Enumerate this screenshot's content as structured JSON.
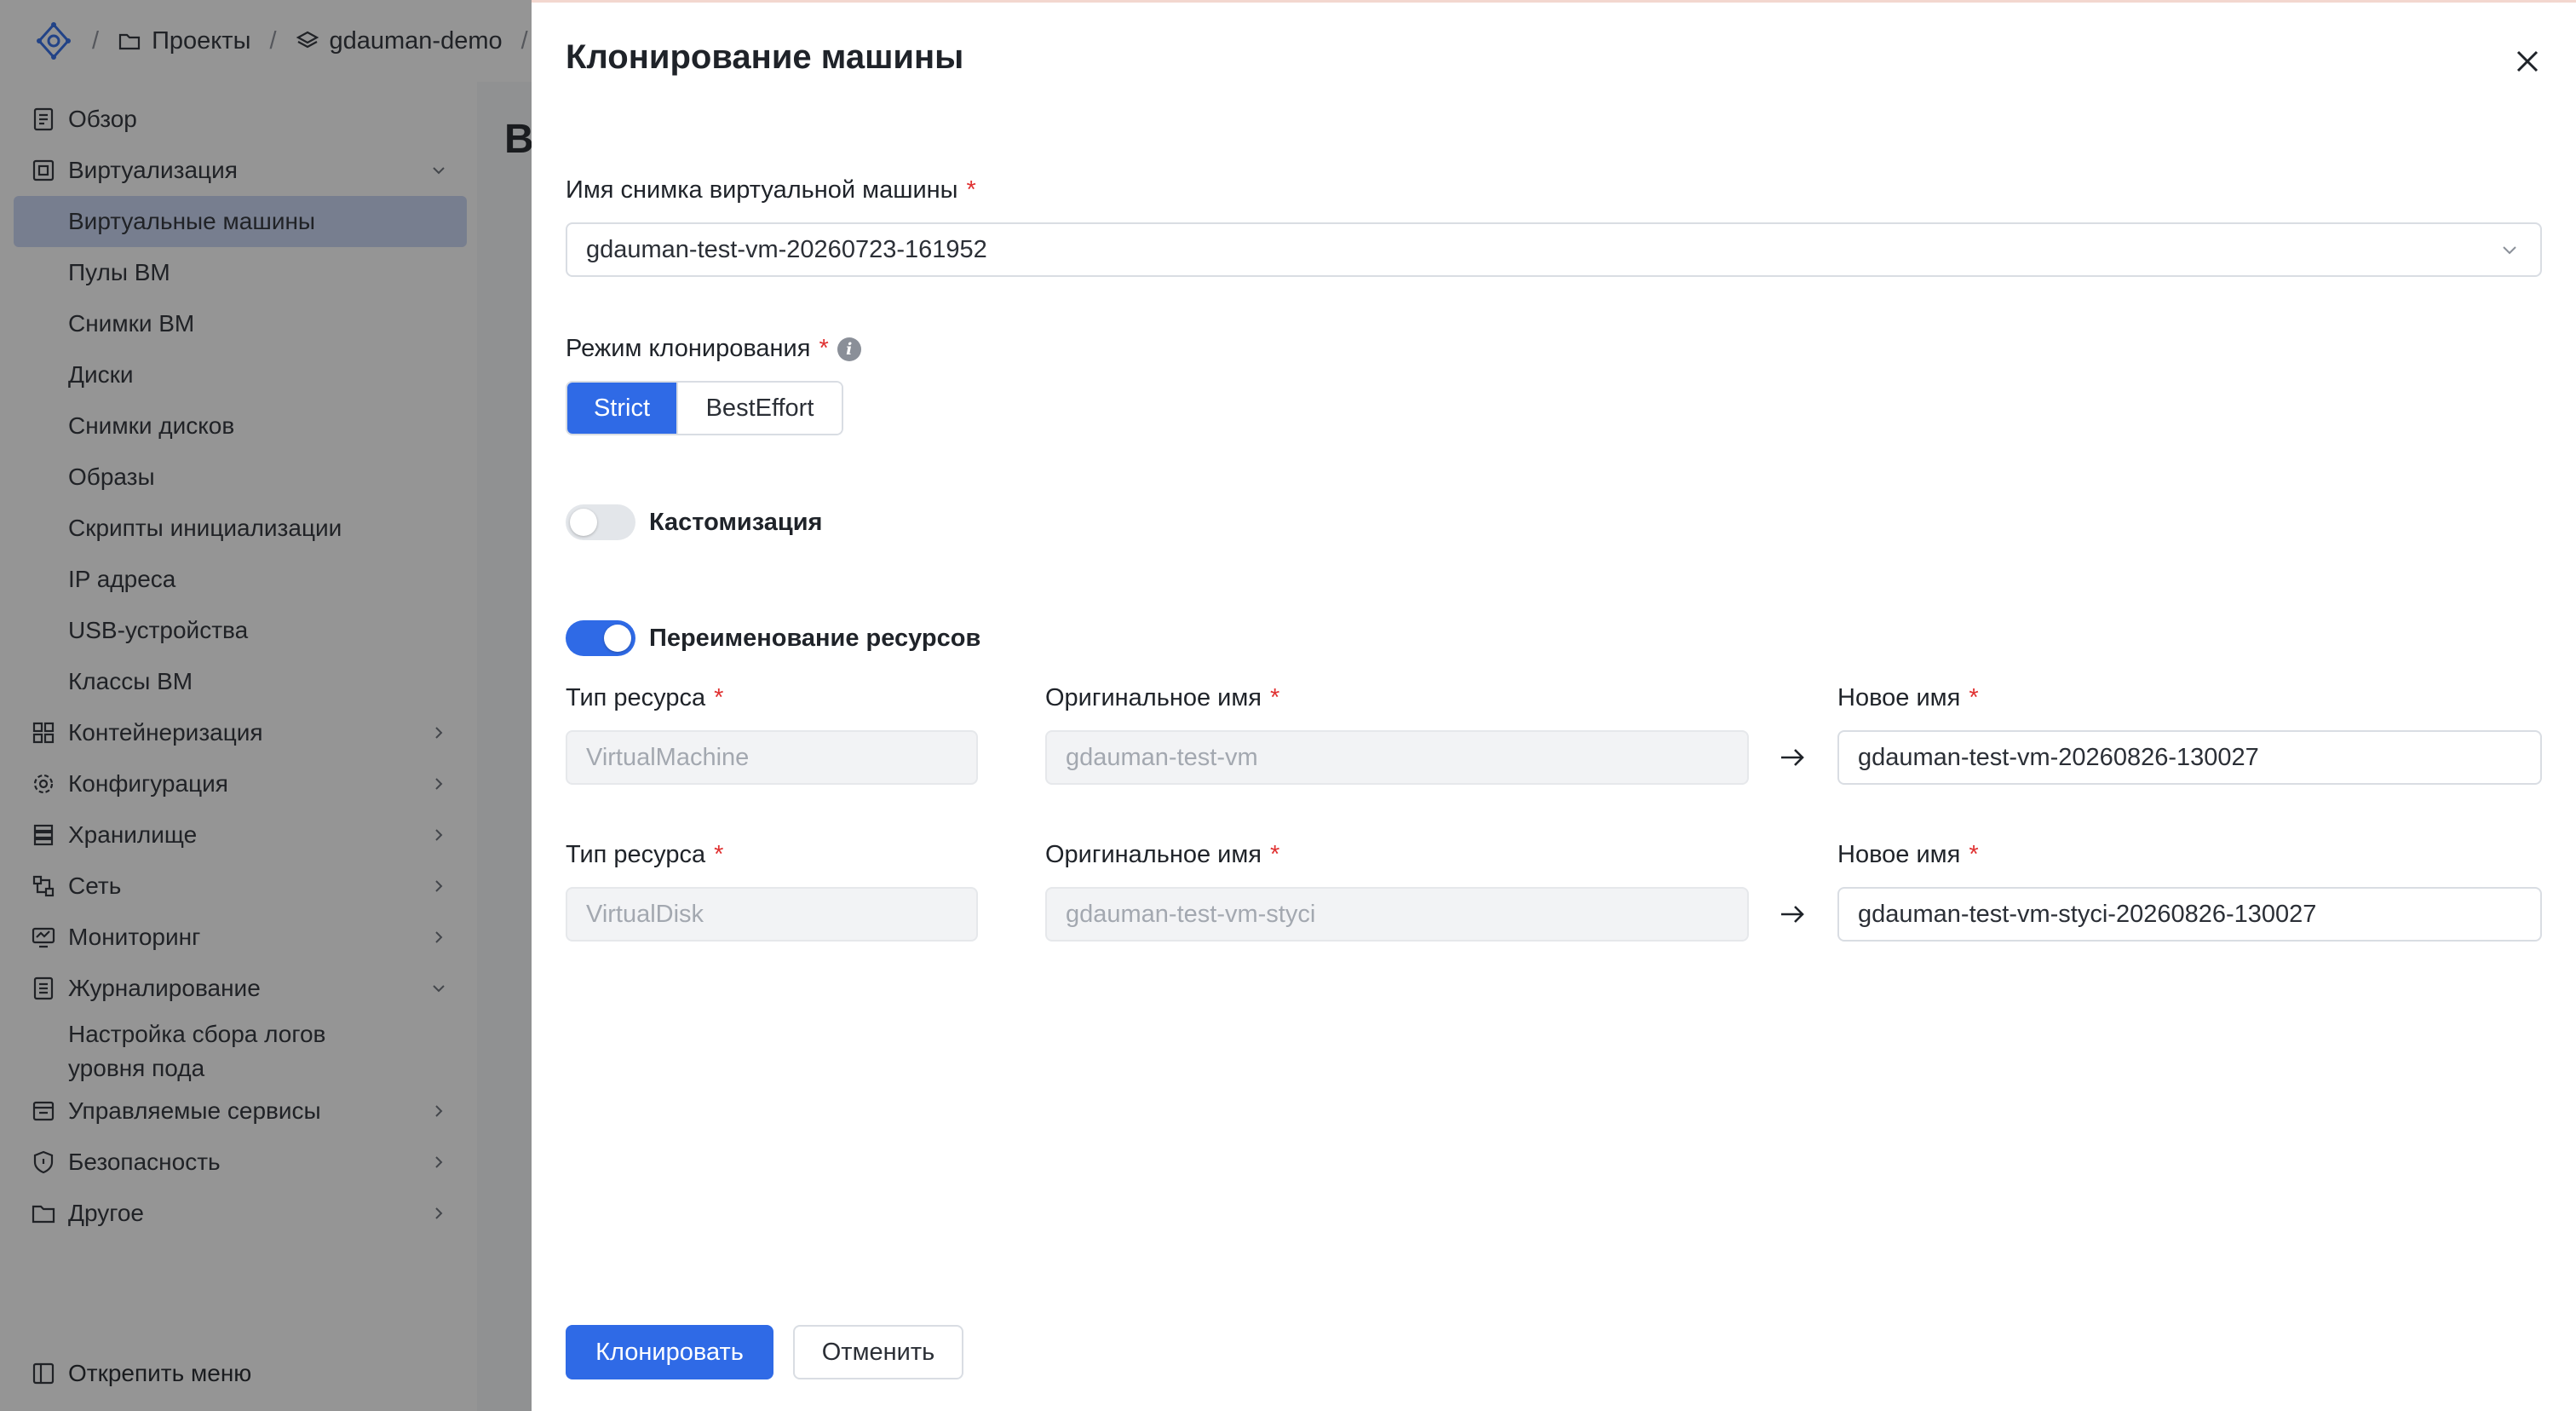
{
  "breadcrumb": {
    "projects": "Проекты",
    "project": "gdauman-demo",
    "separator": "/"
  },
  "sidebar": {
    "items": [
      {
        "label": "Обзор",
        "icon": "overview-icon"
      },
      {
        "label": "Виртуализация",
        "icon": "virtualization-icon",
        "expanded": true
      },
      {
        "label": "Виртуальные машины",
        "active": true
      },
      {
        "label": "Пулы ВМ"
      },
      {
        "label": "Снимки ВМ"
      },
      {
        "label": "Диски"
      },
      {
        "label": "Снимки дисков"
      },
      {
        "label": "Образы"
      },
      {
        "label": "Скрипты инициализации"
      },
      {
        "label": "IP адреса"
      },
      {
        "label": "USB-устройства"
      },
      {
        "label": "Классы ВМ"
      },
      {
        "label": "Контейнеризация",
        "icon": "containers-icon"
      },
      {
        "label": "Конфигурация",
        "icon": "gear-icon"
      },
      {
        "label": "Хранилище",
        "icon": "storage-icon"
      },
      {
        "label": "Сеть",
        "icon": "network-icon"
      },
      {
        "label": "Мониторинг",
        "icon": "monitoring-icon"
      },
      {
        "label": "Журналирование",
        "icon": "logging-icon",
        "expanded": true
      },
      {
        "label": "Настройка сбора логов уровня пода"
      },
      {
        "label": "Управляемые сервисы",
        "icon": "services-icon"
      },
      {
        "label": "Безопасность",
        "icon": "shield-icon"
      },
      {
        "label": "Другое",
        "icon": "folder-icon"
      }
    ],
    "unpin": "Открепить меню"
  },
  "background": {
    "page_letter": "В"
  },
  "drawer": {
    "title": "Клонирование машины",
    "snapshot_label": "Имя снимка виртуальной машины",
    "snapshot_value": "gdauman-test-vm-20260723-161952",
    "mode_label": "Режим клонирования",
    "modes": [
      "Strict",
      "BestEffort"
    ],
    "selected_mode": "Strict",
    "customization_label": "Кастомизация",
    "customization_enabled": false,
    "rename_label": "Переименование ресурсов",
    "rename_enabled": true,
    "required_mark": "*",
    "info_glyph": "i",
    "columns": {
      "type": "Тип ресурса",
      "original": "Оригинальное имя",
      "new": "Новое имя"
    },
    "resources": [
      {
        "type": "VirtualMachine",
        "original": "gdauman-test-vm",
        "new": "gdauman-test-vm-20260826-130027"
      },
      {
        "type": "VirtualDisk",
        "original": "gdauman-test-vm-styci",
        "new": "gdauman-test-vm-styci-20260826-130027"
      }
    ],
    "clone_button": "Клонировать",
    "cancel_button": "Отменить"
  },
  "colors": {
    "accent": "#2f6ae6",
    "required": "#e03131",
    "active_nav": "#c9d6f5",
    "overlay": "rgba(20,20,20,0.45)"
  }
}
